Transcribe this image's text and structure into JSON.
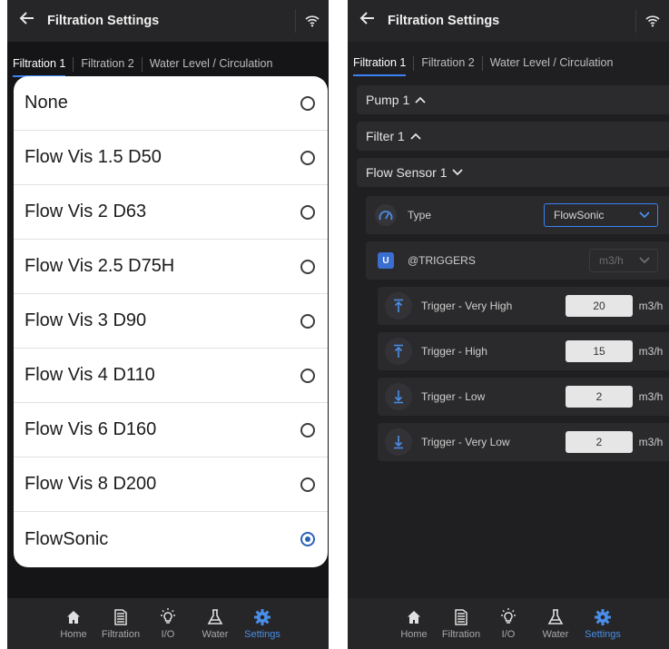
{
  "left": {
    "header": {
      "title": "Filtration Settings"
    },
    "tabs": [
      "Filtration 1",
      "Filtration 2",
      "Water Level / Circulation"
    ],
    "options": [
      {
        "label": "None",
        "selected": false
      },
      {
        "label": "Flow Vis 1.5 D50",
        "selected": false
      },
      {
        "label": "Flow Vis 2 D63",
        "selected": false
      },
      {
        "label": "Flow Vis 2.5 D75H",
        "selected": false
      },
      {
        "label": "Flow Vis 3 D90",
        "selected": false
      },
      {
        "label": "Flow Vis 4 D110",
        "selected": false
      },
      {
        "label": "Flow Vis 6 D160",
        "selected": false
      },
      {
        "label": "Flow Vis 8 D200",
        "selected": false
      },
      {
        "label": "FlowSonic",
        "selected": true
      }
    ]
  },
  "right": {
    "header": {
      "title": "Filtration Settings"
    },
    "tabs": [
      "Filtration 1",
      "Filtration 2",
      "Water Level / Circulation"
    ],
    "sections": {
      "pump": "Pump 1",
      "filter": "Filter 1",
      "flow_sensor": "Flow Sensor 1"
    },
    "type": {
      "label": "Type",
      "value": "FlowSonic"
    },
    "triggers": {
      "label": "@TRIGGERS",
      "unit_select": "m3/h",
      "badge": "U"
    },
    "trigger_rows": [
      {
        "label": "Trigger - Very High",
        "value": "20",
        "unit": "m3/h"
      },
      {
        "label": "Trigger - High",
        "value": "15",
        "unit": "m3/h"
      },
      {
        "label": "Trigger - Low",
        "value": "2",
        "unit": "m3/h"
      },
      {
        "label": "Trigger - Very Low",
        "value": "2",
        "unit": "m3/h"
      }
    ]
  },
  "nav": [
    "Home",
    "Filtration",
    "I/O",
    "Water",
    "Settings"
  ],
  "colors": {
    "accent": "#3b82f6",
    "selected_radio": "#2962b8",
    "background": "#1f1f21"
  }
}
